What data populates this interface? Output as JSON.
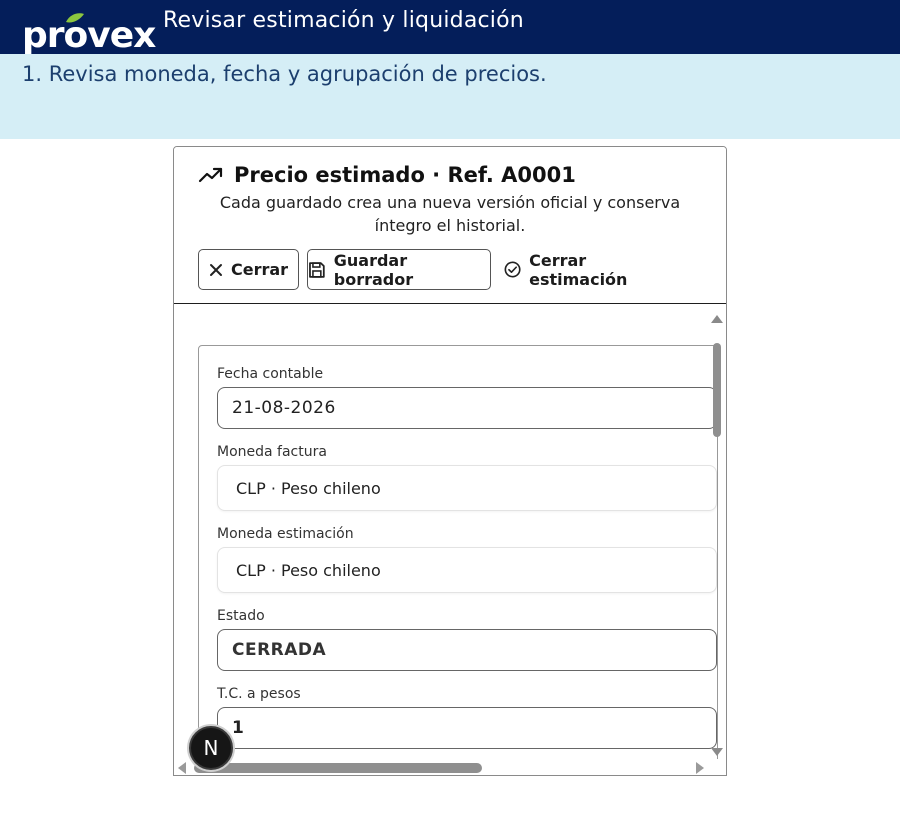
{
  "app": {
    "logo_text": "provex",
    "page_title": "Revisar estimación y liquidación",
    "brand_color": "#041e5a",
    "band_color": "#d5eef6"
  },
  "instruction": {
    "text": "1. Revisa moneda, fecha y agrupación de precios."
  },
  "dialog": {
    "title_icon": "trending-up-icon",
    "title": "Precio estimado · Ref. A0001",
    "subtitle": "Cada guardado crea una nueva versión oficial y conserva íntegro el historial.",
    "buttons": {
      "close_label": "Cerrar",
      "close_icon": "close-icon",
      "save_label": "Guardar borrador",
      "save_icon": "save-icon",
      "finish_label": "Cerrar estimación",
      "finish_icon": "check-circle-icon"
    }
  },
  "form": {
    "accounting_date": {
      "label": "Fecha contable",
      "value": "21-08-2026"
    },
    "invoice_currency": {
      "label": "Moneda factura",
      "value": "CLP · Peso chileno"
    },
    "estimate_currency": {
      "label": "Moneda estimación",
      "value": "CLP · Peso chileno"
    },
    "status": {
      "label": "Estado",
      "value": "CERRADA"
    },
    "exchange_rate": {
      "label": "T.C. a pesos",
      "value": "1"
    }
  },
  "badge": {
    "letter": "N"
  }
}
